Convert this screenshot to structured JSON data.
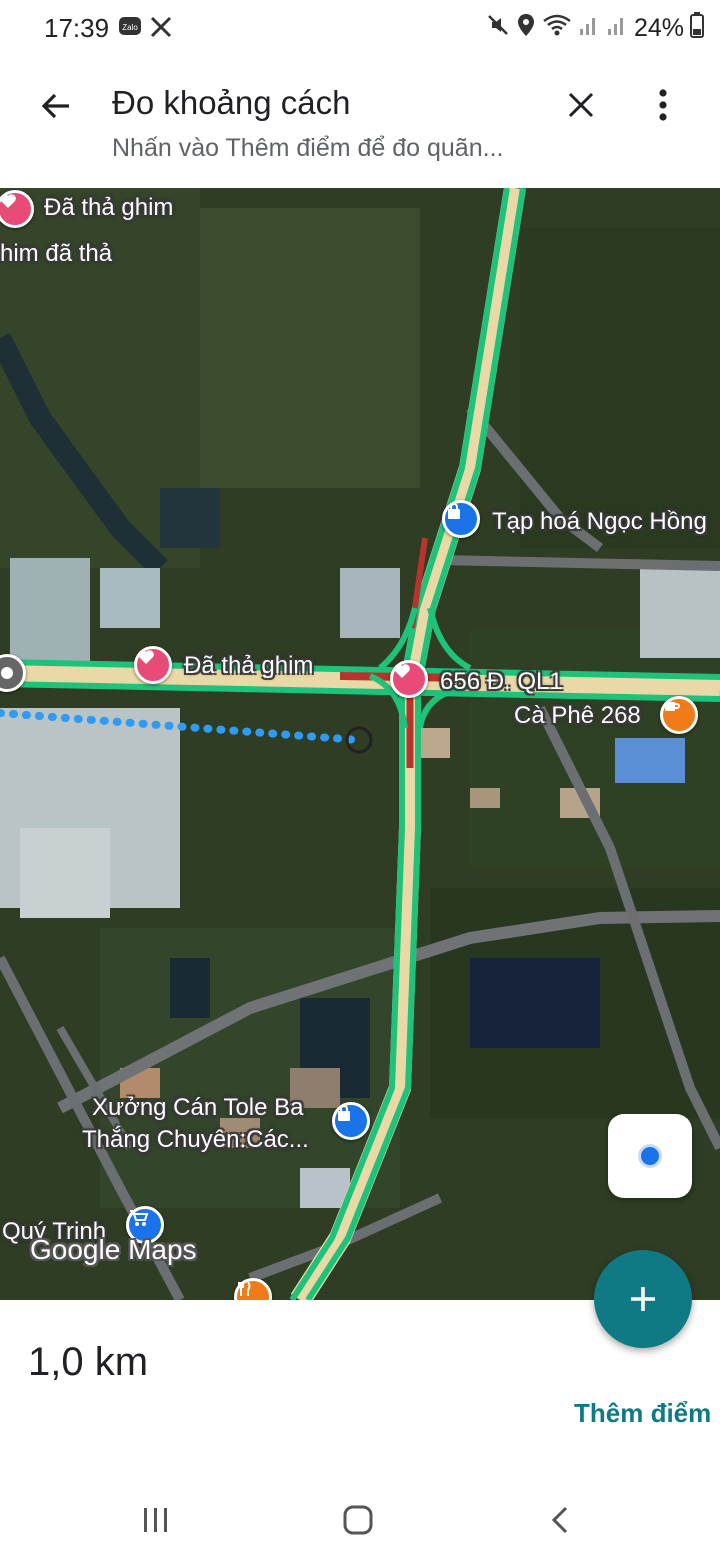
{
  "status_bar": {
    "time": "17:39",
    "app_icons": [
      "zalo-icon",
      "x-icon"
    ],
    "battery": "24%",
    "status_icons": [
      "mute-icon",
      "location-icon",
      "wifi-icon",
      "signal-icon",
      "signal-icon",
      "battery-icon"
    ]
  },
  "app_bar": {
    "title": "Đo khoảng cách",
    "subtitle": "Nhấn vào Thêm điểm để đo quãn..."
  },
  "map": {
    "labels": {
      "pin_top": "Đã thả ghim",
      "pin_top_second": "him đã thả",
      "shop_top": "Tạp hoá Ngọc Hồng",
      "pin_mid": "Đã thả ghim",
      "pin_junction": "656 Đ. QL1",
      "cafe": "Cà Phê 268",
      "shop_bottom_line1": "Xưởng Cán Tole Ba",
      "shop_bottom_line2": "Thắng Chuyên:Các...",
      "cart": "Quý Trinh",
      "logo": "Google Maps"
    }
  },
  "bottom_panel": {
    "distance": "1,0 km",
    "add_point": "Thêm điểm"
  },
  "colors": {
    "accent": "#0f7a84",
    "route_blue": "#2f9bf4",
    "heart_pin": "#e84b78",
    "road_green": "#1fc27a"
  }
}
